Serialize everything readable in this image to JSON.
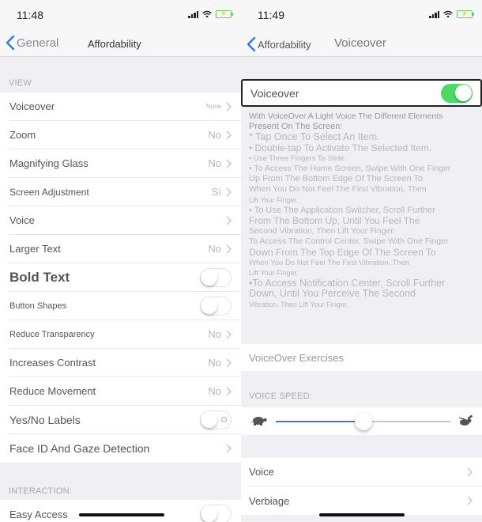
{
  "left": {
    "status": {
      "time": "11:48",
      "battery_label": "⚡"
    },
    "nav": {
      "back_label": "General",
      "title": "Affordability"
    },
    "sections": [
      {
        "header": "VIEW",
        "rows": [
          {
            "label": "Voiceover",
            "value": "None",
            "control": "chevron"
          },
          {
            "label": "Zoom",
            "value": "No",
            "control": "chevron"
          },
          {
            "label": "Magnifying Glass",
            "value": "No",
            "control": "chevron"
          },
          {
            "label": "Screen Adjustment",
            "value": "Sì",
            "control": "chevron"
          },
          {
            "label": "Voice",
            "value": "",
            "control": "chevron"
          },
          {
            "label": "Larger Text",
            "value": "No",
            "control": "chevron"
          },
          {
            "label": "Bold Text",
            "value": "",
            "control": "toggle",
            "on": false
          },
          {
            "label": "Button Shapes",
            "value": "",
            "control": "toggle",
            "on": false
          },
          {
            "label": "Reduce Transparency",
            "value": "No",
            "control": "chevron"
          },
          {
            "label": "Increases Contrast",
            "value": "No",
            "control": "chevron"
          },
          {
            "label": "Reduce Movement",
            "value": "No",
            "control": "chevron"
          },
          {
            "label": "Yes/No Labels",
            "value": "",
            "control": "toggle",
            "on": false
          },
          {
            "label": "Face ID And Gaze Detection",
            "value": "",
            "control": "chevron"
          }
        ]
      },
      {
        "header": "INTERACTION:",
        "rows": [
          {
            "label": "Easy Access",
            "value": "",
            "control": "toggle",
            "on": false
          }
        ]
      }
    ]
  },
  "right": {
    "status": {
      "time": "11:49",
      "battery_label": "⚡"
    },
    "nav": {
      "back_label": "Affordability",
      "title": "Voiceover"
    },
    "voiceover": {
      "label": "Voiceover",
      "on": true
    },
    "description": [
      "With VoiceOver A Light Voice The Different Elements",
      "Present On The Screen:",
      "* Tap Once To Select An Item.",
      "• Double-tap To Activate The Selected Item.",
      "• Use Three Fingers To Slide.",
      "• To Access The Home Screen, Swipe With One Finger",
      "Up From The Bottom Edge Of The Screen To",
      "When You Do Not Feel The First Vibration, Then",
      "Lift Your Finger.",
      "• To Use The Application Switcher, Scroll Further",
      "From The Bottom Up, Until You Feel The",
      "Second Vibration, Then Lift Your Finger.",
      "To Access The Control Center, Swipe With One Finger",
      "Down From The Top Edge Of The Screen To",
      "When You Do Not Feel The First Vibration, Then",
      "Lift Your Finger.",
      "•To Access Notification Center, Scroll Further",
      "Down, Until You Perceive The Second",
      "Vibration, Then Lift Your Finger."
    ],
    "exercises_label": "VoiceOver Exercises",
    "speed_header": "VOICE SPEED:",
    "speed_value": 0.5,
    "rows": [
      {
        "label": "Voice"
      },
      {
        "label": "Verbiage"
      }
    ]
  },
  "colors": {
    "toggle_on": "#4cd964",
    "accent": "#3d7bd1",
    "back_chevron": "#2f7ae5"
  }
}
